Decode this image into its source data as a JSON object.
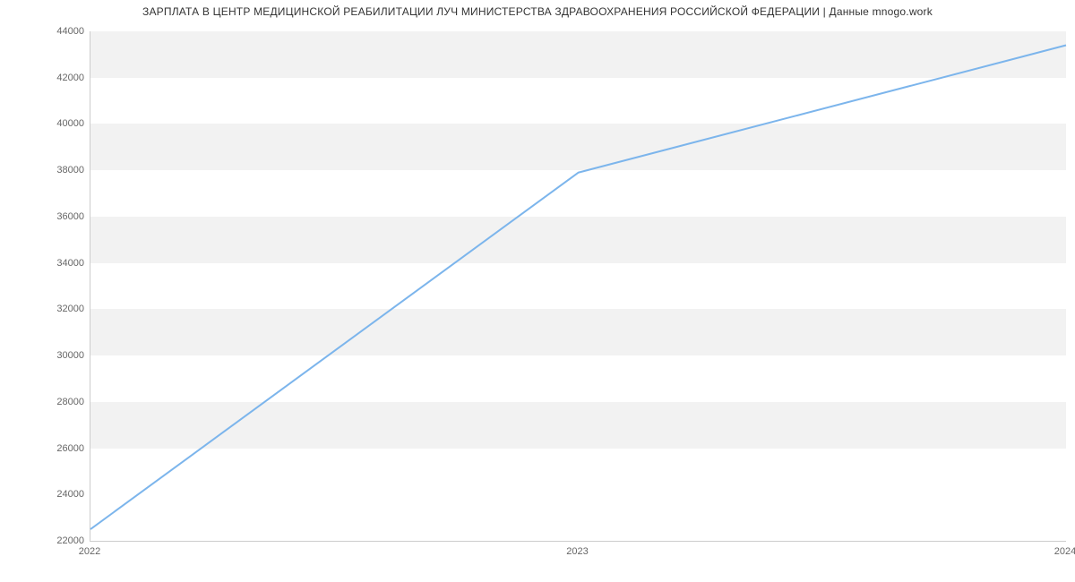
{
  "chart_data": {
    "type": "line",
    "title": "ЗАРПЛАТА В  ЦЕНТР МЕДИЦИНСКОЙ РЕАБИЛИТАЦИИ  ЛУЧ МИНИСТЕРСТВА ЗДРАВООХРАНЕНИЯ РОССИЙСКОЙ ФЕДЕРАЦИИ | Данные mnogo.work",
    "x": [
      2022,
      2023,
      2024
    ],
    "values": [
      22500,
      37900,
      43400
    ],
    "x_ticks": [
      2022,
      2023,
      2024
    ],
    "y_ticks": [
      22000,
      24000,
      26000,
      28000,
      30000,
      32000,
      34000,
      36000,
      38000,
      40000,
      42000,
      44000
    ],
    "xlim": [
      2022,
      2024
    ],
    "ylim": [
      22000,
      44000
    ],
    "line_color": "#7cb5ec",
    "band_color": "#f2f2f2"
  }
}
